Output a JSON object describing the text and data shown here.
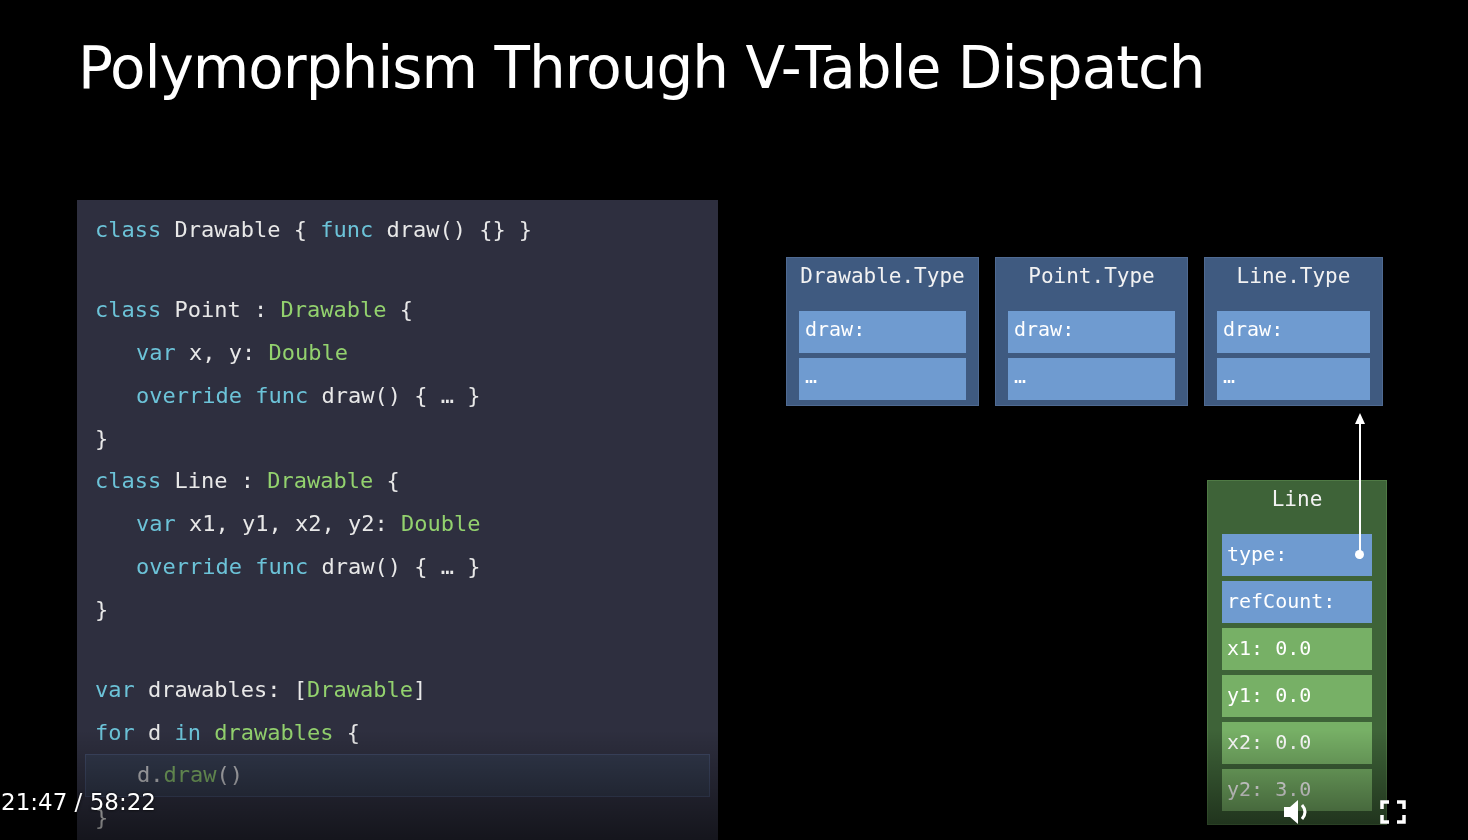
{
  "slide": {
    "title": "Polymorphism Through V-Table Dispatch",
    "code": [
      {
        "highlighted": false,
        "tokens": [
          {
            "t": "class",
            "kind": "keyword"
          },
          {
            "t": " Drawable { ",
            "kind": "plain"
          },
          {
            "t": "func",
            "kind": "keyword"
          },
          {
            "t": " draw() {} }",
            "kind": "plain"
          }
        ]
      },
      {
        "highlighted": false
      },
      {
        "highlighted": false,
        "tokens": [
          {
            "t": "class",
            "kind": "keyword"
          },
          {
            "t": " Point : ",
            "kind": "plain"
          },
          {
            "t": "Drawable",
            "kind": "type"
          },
          {
            "t": " {",
            "kind": "plain"
          }
        ],
        "children": [
          {
            "highlighted": false,
            "tokens": [
              {
                "t": "var",
                "kind": "keyword"
              },
              {
                "t": " x, y: ",
                "kind": "plain"
              },
              {
                "t": "Double",
                "kind": "type"
              }
            ]
          },
          {
            "highlighted": false,
            "tokens": [
              {
                "t": "override",
                "kind": "keyword"
              },
              {
                "t": " func",
                "kind": "keyword"
              },
              {
                "t": " draw() { … }",
                "kind": "plain"
              }
            ]
          }
        ]
      },
      {
        "highlighted": false,
        "tokens": [
          {
            "t": "}",
            "kind": "plain"
          }
        ]
      },
      {
        "highlighted": false,
        "tokens": [
          {
            "t": "class",
            "kind": "keyword"
          },
          {
            "t": " Line : ",
            "kind": "plain"
          },
          {
            "t": "Drawable",
            "kind": "type"
          },
          {
            "t": " {",
            "kind": "plain"
          }
        ],
        "children": [
          {
            "highlighted": false,
            "tokens": [
              {
                "t": "var",
                "kind": "keyword"
              },
              {
                "t": " x1, y1, x2, y2: ",
                "kind": "plain"
              },
              {
                "t": "Double",
                "kind": "type"
              }
            ]
          },
          {
            "highlighted": false,
            "tokens": [
              {
                "t": "override",
                "kind": "keyword"
              },
              {
                "t": " func",
                "kind": "keyword"
              },
              {
                "t": " draw() { … }",
                "kind": "plain"
              }
            ]
          }
        ]
      },
      {
        "highlighted": false,
        "tokens": [
          {
            "t": "}",
            "kind": "plain"
          }
        ]
      },
      {
        "highlighted": false
      },
      {
        "highlighted": false,
        "tokens": [
          {
            "t": "var",
            "kind": "keyword"
          },
          {
            "t": " drawables: [",
            "kind": "plain"
          },
          {
            "t": "Drawable",
            "kind": "type"
          },
          {
            "t": "]",
            "kind": "plain"
          }
        ]
      },
      {
        "highlighted": false,
        "tokens": [
          {
            "t": "for",
            "kind": "keyword"
          },
          {
            "t": " d ",
            "kind": "plain"
          },
          {
            "t": "in",
            "kind": "keyword"
          },
          {
            "t": " drawables",
            "kind": "type"
          },
          {
            "t": " {",
            "kind": "plain"
          }
        ],
        "children": [
          {
            "highlighted": true,
            "tokens": [
              {
                "t": "d.",
                "kind": "plain"
              },
              {
                "t": "draw",
                "kind": "type"
              },
              {
                "t": "()",
                "kind": "plain"
              }
            ]
          }
        ]
      },
      {
        "highlighted": false,
        "tokens": [
          {
            "t": "}",
            "kind": "plain"
          }
        ]
      }
    ],
    "type_tables": [
      {
        "title": "Drawable.Type",
        "slots": [
          "draw:",
          "…"
        ]
      },
      {
        "title": "Point.Type",
        "slots": [
          "draw:",
          "…"
        ]
      },
      {
        "title": "Line.Type",
        "slots": [
          "draw:",
          "…"
        ]
      }
    ],
    "instance": {
      "title": "Line",
      "fields": [
        {
          "label": "type:",
          "kind": "pointer"
        },
        {
          "label": "refCount:",
          "kind": "header"
        },
        {
          "label": "x1: 0.0",
          "kind": "value"
        },
        {
          "label": "y1: 0.0",
          "kind": "value"
        },
        {
          "label": "x2: 0.0",
          "kind": "value"
        },
        {
          "label": "y2: 3.0",
          "kind": "value"
        }
      ]
    }
  },
  "player": {
    "time": "21:47 / 58:22"
  }
}
